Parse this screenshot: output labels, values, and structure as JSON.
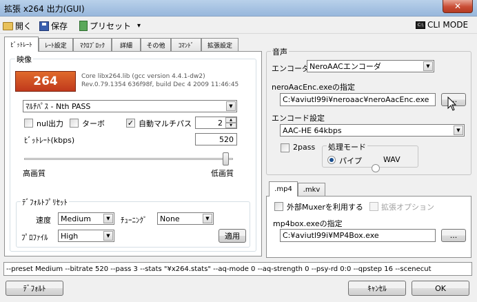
{
  "window": {
    "title": "拡張 x264 出力(GUI)",
    "close_label": "✕"
  },
  "toolbar": {
    "open_label": "開く",
    "save_label": "保存",
    "preset_label": "プリセット",
    "preset_arrow": "▾",
    "cli_label": "CLI MODE",
    "cli_icon_text": "C:\\"
  },
  "tabs": [
    {
      "label": "ﾋﾞｯﾄﾚｰﾄ",
      "active": true
    },
    {
      "label": "ﾚｰﾄ設定",
      "active": false
    },
    {
      "label": "ﾏｸﾛﾌﾞﾛｯｸ",
      "active": false
    },
    {
      "label": "詳細",
      "active": false
    },
    {
      "label": "その他",
      "active": false
    },
    {
      "label": "ｺﾏﾝﾄﾞ",
      "active": false
    },
    {
      "label": "拡張設定",
      "active": false
    }
  ],
  "video": {
    "group_label": "映像",
    "logo_text": "264",
    "core_info_1": "Core libx264.lib (gcc version  4.4.1-dw2)",
    "core_info_2": "Rev.0.79.1354 636f98f, build Dec  4 2009 11:46:45",
    "mode_select": "ﾏﾙﾁﾊﾟｽ - Nth PASS",
    "nul_label": "nul出力",
    "nul_checked": false,
    "turbo_label": "ターボ",
    "turbo_checked": false,
    "auto_multipass_label": "自動マルチパス",
    "auto_multipass_checked": true,
    "auto_multipass_count": "2",
    "bitrate_label": "ﾋﾞｯﾄﾚｰﾄ(kbps)",
    "bitrate_value": "520",
    "quality_left": "高画質",
    "quality_right": "低画質",
    "quality_slider_fraction": 0.98,
    "check_mark": "✓",
    "spin_up": "▲",
    "spin_down": "▼",
    "select_arrow": "▼"
  },
  "default_preset": {
    "group_label": "ﾃﾞﾌｫﾙﾄﾌﾟﾘｾｯﾄ",
    "speed_label": "速度",
    "speed_value": "Medium",
    "tuning_label": "ﾁｭｰﾆﾝｸﾞ",
    "tuning_value": "None",
    "profile_label": "ﾌﾟﾛﾌｧｲﾙ",
    "profile_value": "High",
    "apply_label": "適用"
  },
  "audio": {
    "group_label": "音声",
    "encoder_label": "エンコーダ",
    "encoder_value": "NeroAACエンコーダ",
    "exe_label": "neroAacEnc.exeの指定",
    "exe_path": "C:¥aviutl99i¥neroaac¥neroAacEnc.exe",
    "browse_label": "...",
    "encode_settings_label": "エンコード設定",
    "encode_settings_value": "AAC-HE 64kbps",
    "twopass_label": "2pass",
    "twopass_checked": false,
    "process_mode_label": "処理モード",
    "pipe_label": "パイプ",
    "pipe_selected": true,
    "wav_label": "WAV",
    "wav_selected": false
  },
  "mux": {
    "tabs": [
      {
        "label": ".mp4",
        "active": true
      },
      {
        "label": ".mkv",
        "active": false
      }
    ],
    "external_muxer_label": "外部Muxerを利用する",
    "external_muxer_checked": false,
    "ext_option_label": "拡張オプション",
    "ext_option_checked": false,
    "mp4box_label": "mp4box.exeの指定",
    "mp4box_path": "C:¥aviutl99i¥MP4Box.exe",
    "browse_label": "..."
  },
  "command_line": "--preset Medium --bitrate 520 --pass 3 --stats \"¥x264.stats\" --aq-mode 0 --aq-strength 0 --psy-rd 0:0 --qpstep 16 --scenecut",
  "footer": {
    "default_label": "ﾃﾞﾌｫﾙﾄ",
    "cancel_label": "ｷｬﾝｾﾙ",
    "ok_label": "OK"
  },
  "colors": {
    "title_bar": "#a6c2e2",
    "close_button": "#c94d35",
    "radio_dot": "#1a4f8f"
  }
}
